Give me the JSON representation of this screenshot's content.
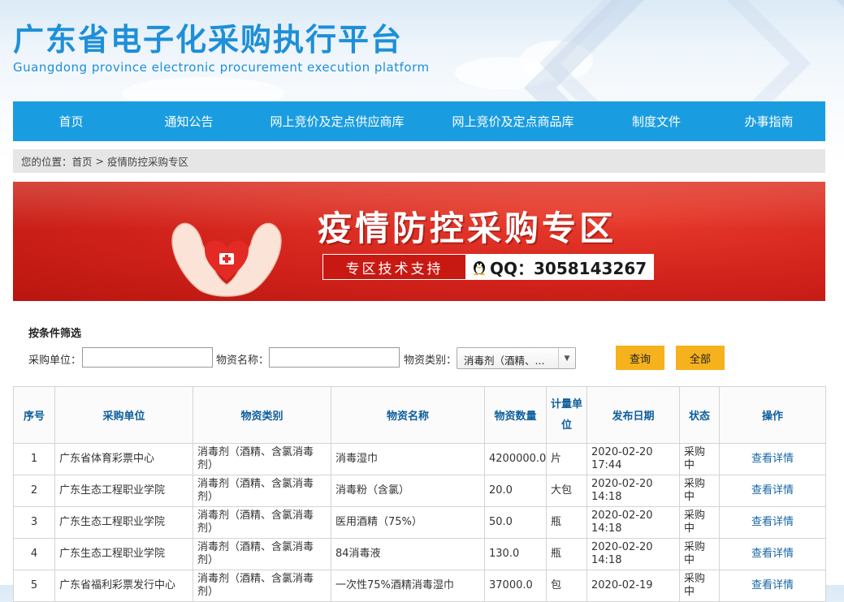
{
  "site": {
    "title": "广东省电子化采购执行平台",
    "subtitle": "Guangdong province electronic procurement execution platform"
  },
  "nav": {
    "items": [
      {
        "label": "首页"
      },
      {
        "label": "通知公告"
      },
      {
        "label": "网上竞价及定点供应商库"
      },
      {
        "label": "网上竞价及定点商品库"
      },
      {
        "label": "制度文件"
      },
      {
        "label": "办事指南"
      }
    ]
  },
  "breadcrumb": {
    "prefix": "您的位置：",
    "home": "首页",
    "separator": " > ",
    "current": "疫情防控采购专区"
  },
  "banner": {
    "title": "疫情防控采购专区",
    "support_label": "专区技术支持",
    "qq_text": "QQ：3058143267",
    "colors": {
      "background": "#d1221b",
      "accent": "#ffffff"
    }
  },
  "filter": {
    "title": "按条件筛选",
    "unit_label": "采购单位：",
    "unit_value": "",
    "name_label": "物资名称：",
    "name_value": "",
    "category_label": "物资类别：",
    "category_selected": "消毒剂（酒精、...",
    "query_button": "查询",
    "all_button": "全部",
    "button_color": "#f5b21d"
  },
  "table": {
    "headers": {
      "no": "序号",
      "unit": "采购单位",
      "category": "物资类别",
      "name": "物资名称",
      "qty": "物资数量",
      "measure": "计量单位",
      "date": "发布日期",
      "status": "状态",
      "action": "操作"
    },
    "rows": [
      {
        "no": "1",
        "unit": "广东省体育彩票中心",
        "category": "消毒剂（酒精、含氯消毒剂）",
        "name": "消毒湿巾",
        "qty": "4200000.0",
        "measure": "片",
        "date": "2020-02-20 17:44",
        "status": "采购中",
        "action": "查看详情"
      },
      {
        "no": "2",
        "unit": "广东生态工程职业学院",
        "category": "消毒剂（酒精、含氯消毒剂）",
        "name": "消毒粉（含氯）",
        "qty": "20.0",
        "measure": "大包",
        "date": "2020-02-20 14:18",
        "status": "采购中",
        "action": "查看详情"
      },
      {
        "no": "3",
        "unit": "广东生态工程职业学院",
        "category": "消毒剂（酒精、含氯消毒剂）",
        "name": "医用酒精（75%）",
        "qty": "50.0",
        "measure": "瓶",
        "date": "2020-02-20 14:18",
        "status": "采购中",
        "action": "查看详情"
      },
      {
        "no": "4",
        "unit": "广东生态工程职业学院",
        "category": "消毒剂（酒精、含氯消毒剂）",
        "name": "84消毒液",
        "qty": "130.0",
        "measure": "瓶",
        "date": "2020-02-20 14:18",
        "status": "采购中",
        "action": "查看详情"
      },
      {
        "no": "5",
        "unit": "广东省福利彩票发行中心",
        "category": "消毒剂（酒精、含氯消毒剂）",
        "name": "一次性75%酒精消毒湿巾",
        "qty": "37000.0",
        "measure": "包",
        "date": "2020-02-19",
        "status": "采购中",
        "action": "查看详情"
      }
    ]
  }
}
